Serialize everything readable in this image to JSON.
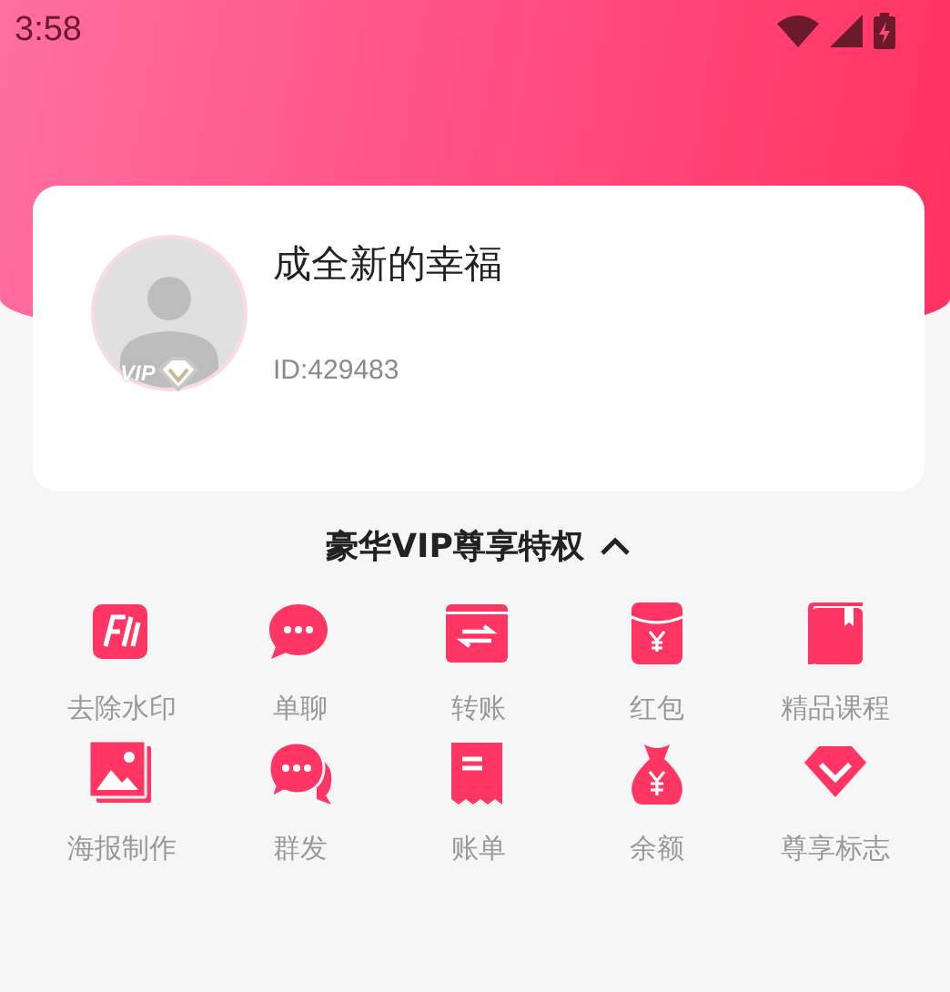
{
  "status_bar": {
    "time": "3:58"
  },
  "profile": {
    "name": "成全新的幸福",
    "id": "ID:429483",
    "vip_badge": "VIP"
  },
  "privileges": {
    "title": "豪华VIP尊享特权",
    "expanded": true,
    "items": [
      {
        "label": "去除水印"
      },
      {
        "label": "单聊"
      },
      {
        "label": "转账"
      },
      {
        "label": "红包"
      },
      {
        "label": "精品课程"
      },
      {
        "label": "海报制作"
      },
      {
        "label": "群发"
      },
      {
        "label": "账单"
      },
      {
        "label": "余额"
      },
      {
        "label": "尊享标志"
      }
    ]
  }
}
